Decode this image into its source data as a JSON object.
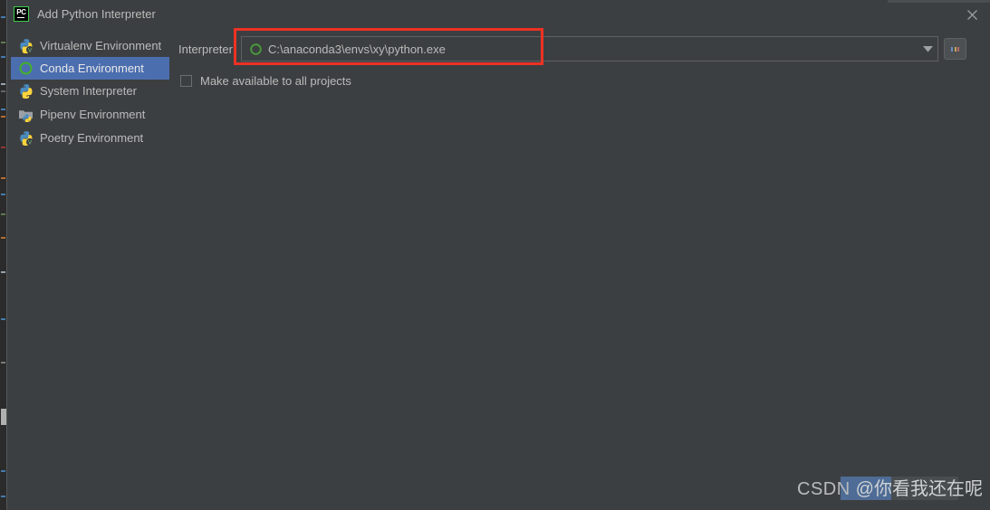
{
  "window": {
    "title": "Add Python Interpreter",
    "logo_text": "PC",
    "logo_icon": "pycharm-logo-icon",
    "close_icon": "close-icon"
  },
  "sidebar": {
    "items": [
      {
        "label": "Virtualenv Environment",
        "icon": "python-venv-icon",
        "selected": false
      },
      {
        "label": "Conda Environment",
        "icon": "conda-circle-icon",
        "selected": true
      },
      {
        "label": "System Interpreter",
        "icon": "python-icon",
        "selected": false
      },
      {
        "label": "Pipenv Environment",
        "icon": "pipenv-folder-icon",
        "selected": false
      },
      {
        "label": "Poetry Environment",
        "icon": "python-poetry-icon",
        "selected": false
      }
    ]
  },
  "main": {
    "interpreter_label": "Interpreter:",
    "interpreter_value": "C:\\anaconda3\\envs\\xy\\python.exe",
    "interpreter_icon": "conda-circle-icon",
    "dropdown_icon": "chevron-down-icon",
    "browse_button_label": "...",
    "browse_icon": "ellipsis-icon",
    "checkbox_label": "Make available to all projects",
    "checkbox_checked": false
  },
  "annotation": {
    "color": "#ee3124",
    "target": "interpreter-field"
  },
  "watermark": {
    "prefix": "CSDN",
    "handle": "@你看我还在呢"
  },
  "colors": {
    "background": "#3c3f41",
    "selection": "#4b6eaf",
    "text": "#bbbbbb",
    "accent_green": "#43a047",
    "annotation_red": "#ee3124",
    "border": "#5e6060"
  }
}
